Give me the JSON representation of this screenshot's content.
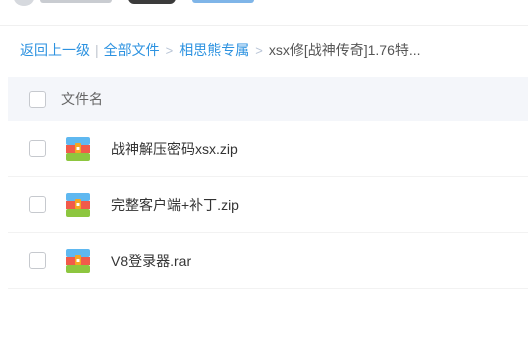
{
  "breadcrumb": {
    "back_label": "返回上一级",
    "all_files_label": "全部文件",
    "folder_label": "相思熊专属",
    "current_label": "xsx修[战神传奇]1.76特...",
    "separator": ">",
    "divider": "|"
  },
  "list": {
    "header": {
      "name_column": "文件名"
    },
    "files": [
      {
        "name": "战神解压密码xsx.zip",
        "icon": "archive-file-icon"
      },
      {
        "name": "完整客户端+补丁.zip",
        "icon": "archive-file-icon"
      },
      {
        "name": "V8登录器.rar",
        "icon": "archive-file-icon"
      }
    ]
  },
  "colors": {
    "link": "#2c92e0",
    "header_bg": "#f4f6fa",
    "icon_top": "#5fb8f0",
    "icon_mid": "#f15a4a",
    "icon_bottom": "#8dc63f",
    "icon_clip": "#f5a623"
  }
}
